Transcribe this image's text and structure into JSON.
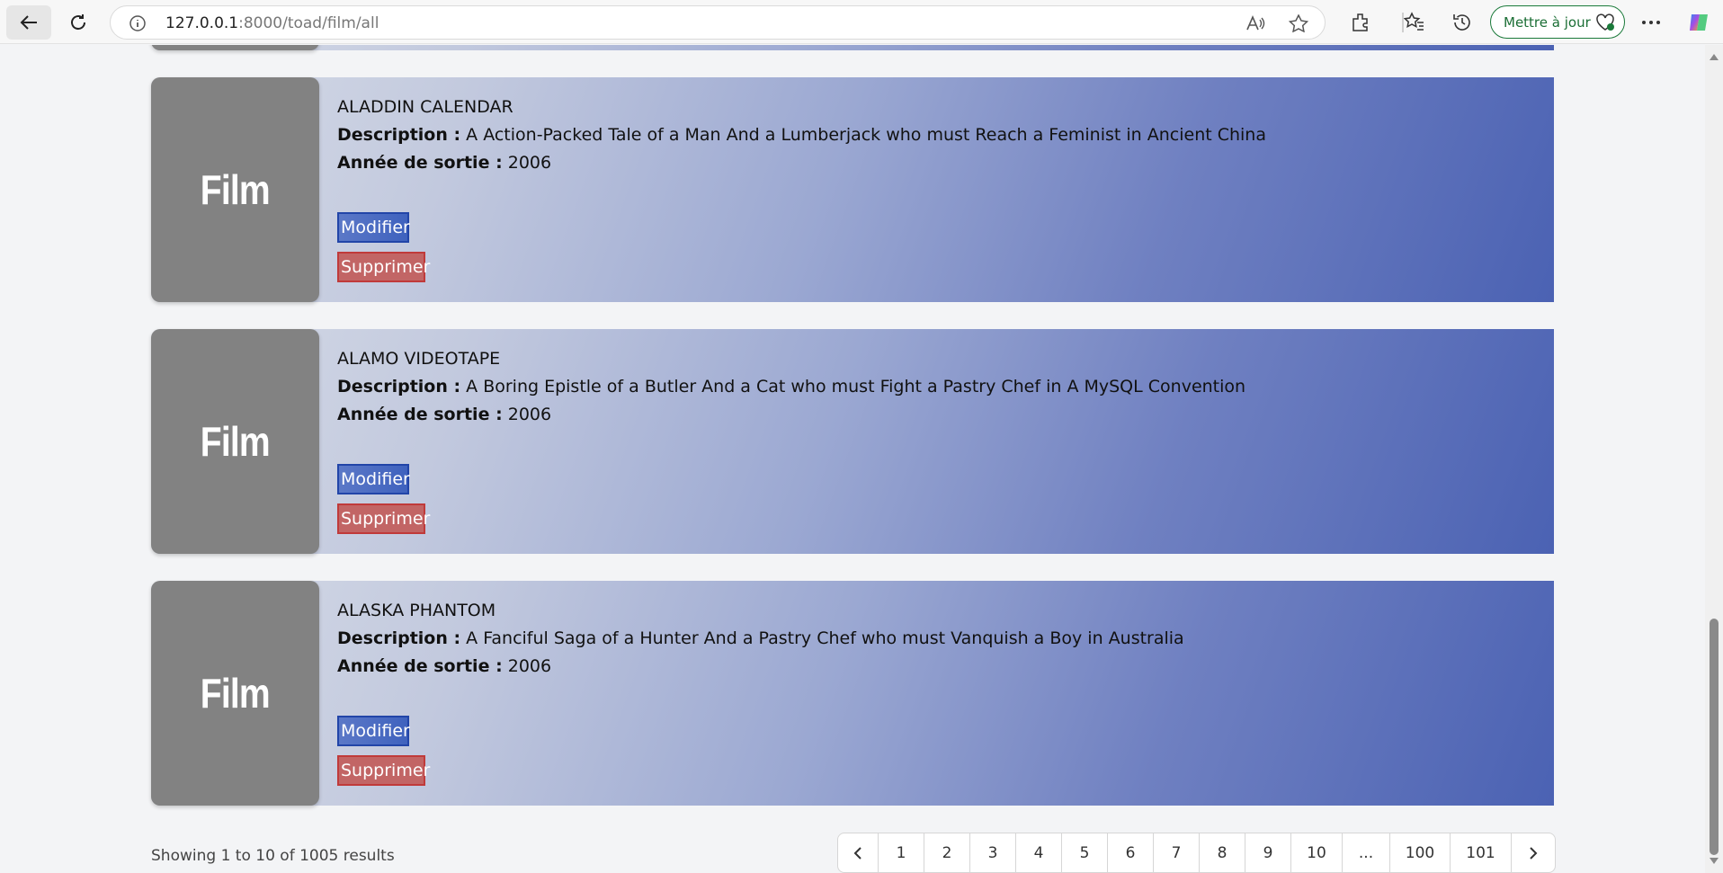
{
  "browser": {
    "url_host": "127.0.0.1",
    "url_rest": ":8000/toad/film/all",
    "update_label": "Mettre à jour"
  },
  "films": [
    {
      "thumb_label": "Film",
      "title": "ALADDIN CALENDAR",
      "description_label": "Description :",
      "description": "A Action-Packed Tale of a Man And a Lumberjack who must Reach a Feminist in Ancient China",
      "year_label": "Année de sortie :",
      "year": "2006",
      "edit_label": "Modifier",
      "delete_label": "Supprimer"
    },
    {
      "thumb_label": "Film",
      "title": "ALAMO VIDEOTAPE",
      "description_label": "Description :",
      "description": "A Boring Epistle of a Butler And a Cat who must Fight a Pastry Chef in A MySQL Convention",
      "year_label": "Année de sortie :",
      "year": "2006",
      "edit_label": "Modifier",
      "delete_label": "Supprimer"
    },
    {
      "thumb_label": "Film",
      "title": "ALASKA PHANTOM",
      "description_label": "Description :",
      "description": "A Fanciful Saga of a Hunter And a Pastry Chef who must Vanquish a Boy in Australia",
      "year_label": "Année de sortie :",
      "year": "2006",
      "edit_label": "Modifier",
      "delete_label": "Supprimer"
    }
  ],
  "pagination": {
    "summary": "Showing 1 to 10 of 1005 results",
    "prev": "‹",
    "pages": [
      "1",
      "2",
      "3",
      "4",
      "5",
      "6",
      "7",
      "8",
      "9",
      "10",
      "...",
      "100",
      "101"
    ],
    "next": "›"
  }
}
